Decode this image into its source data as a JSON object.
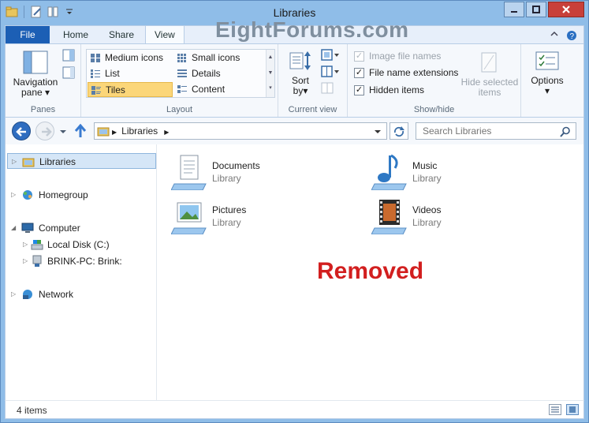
{
  "window": {
    "title": "Libraries"
  },
  "watermark": "EightForums.com",
  "tabs": {
    "file": "File",
    "home": "Home",
    "share": "Share",
    "view": "View"
  },
  "ribbon": {
    "panes": {
      "label": "Panes",
      "navigation_pane": "Navigation",
      "navigation_pane_2": "pane"
    },
    "layout": {
      "label": "Layout",
      "items": [
        "Medium icons",
        "Small icons",
        "List",
        "Details",
        "Tiles",
        "Content"
      ],
      "selected": "Tiles"
    },
    "current_view": {
      "label": "Current view",
      "sort_by": "Sort",
      "sort_by_2": "by"
    },
    "show_hide": {
      "label": "Show/hide",
      "image_file_names": "Image file names",
      "file_name_extensions": "File name extensions",
      "hidden_items": "Hidden items",
      "hide_selected": "Hide selected",
      "hide_selected_2": "items"
    },
    "options": "Options"
  },
  "address": {
    "crumb": "Libraries"
  },
  "search": {
    "placeholder": "Search Libraries"
  },
  "nav": {
    "libraries": "Libraries",
    "homegroup": "Homegroup",
    "computer": "Computer",
    "local_disk": "Local Disk (C:)",
    "brink": "BRINK-PC: Brink:",
    "network": "Network"
  },
  "tiles": [
    {
      "name": "Documents",
      "type": "Library",
      "icon": "documents-library-icon"
    },
    {
      "name": "Music",
      "type": "Library",
      "icon": "music-library-icon"
    },
    {
      "name": "Pictures",
      "type": "Library",
      "icon": "pictures-library-icon"
    },
    {
      "name": "Videos",
      "type": "Library",
      "icon": "videos-library-icon"
    }
  ],
  "overlay_text": "Removed",
  "status": {
    "count": "4 items"
  },
  "colors": {
    "accent": "#1c5fb5",
    "removed_text": "#d21f1f",
    "selected_layout": "#fbd679"
  }
}
